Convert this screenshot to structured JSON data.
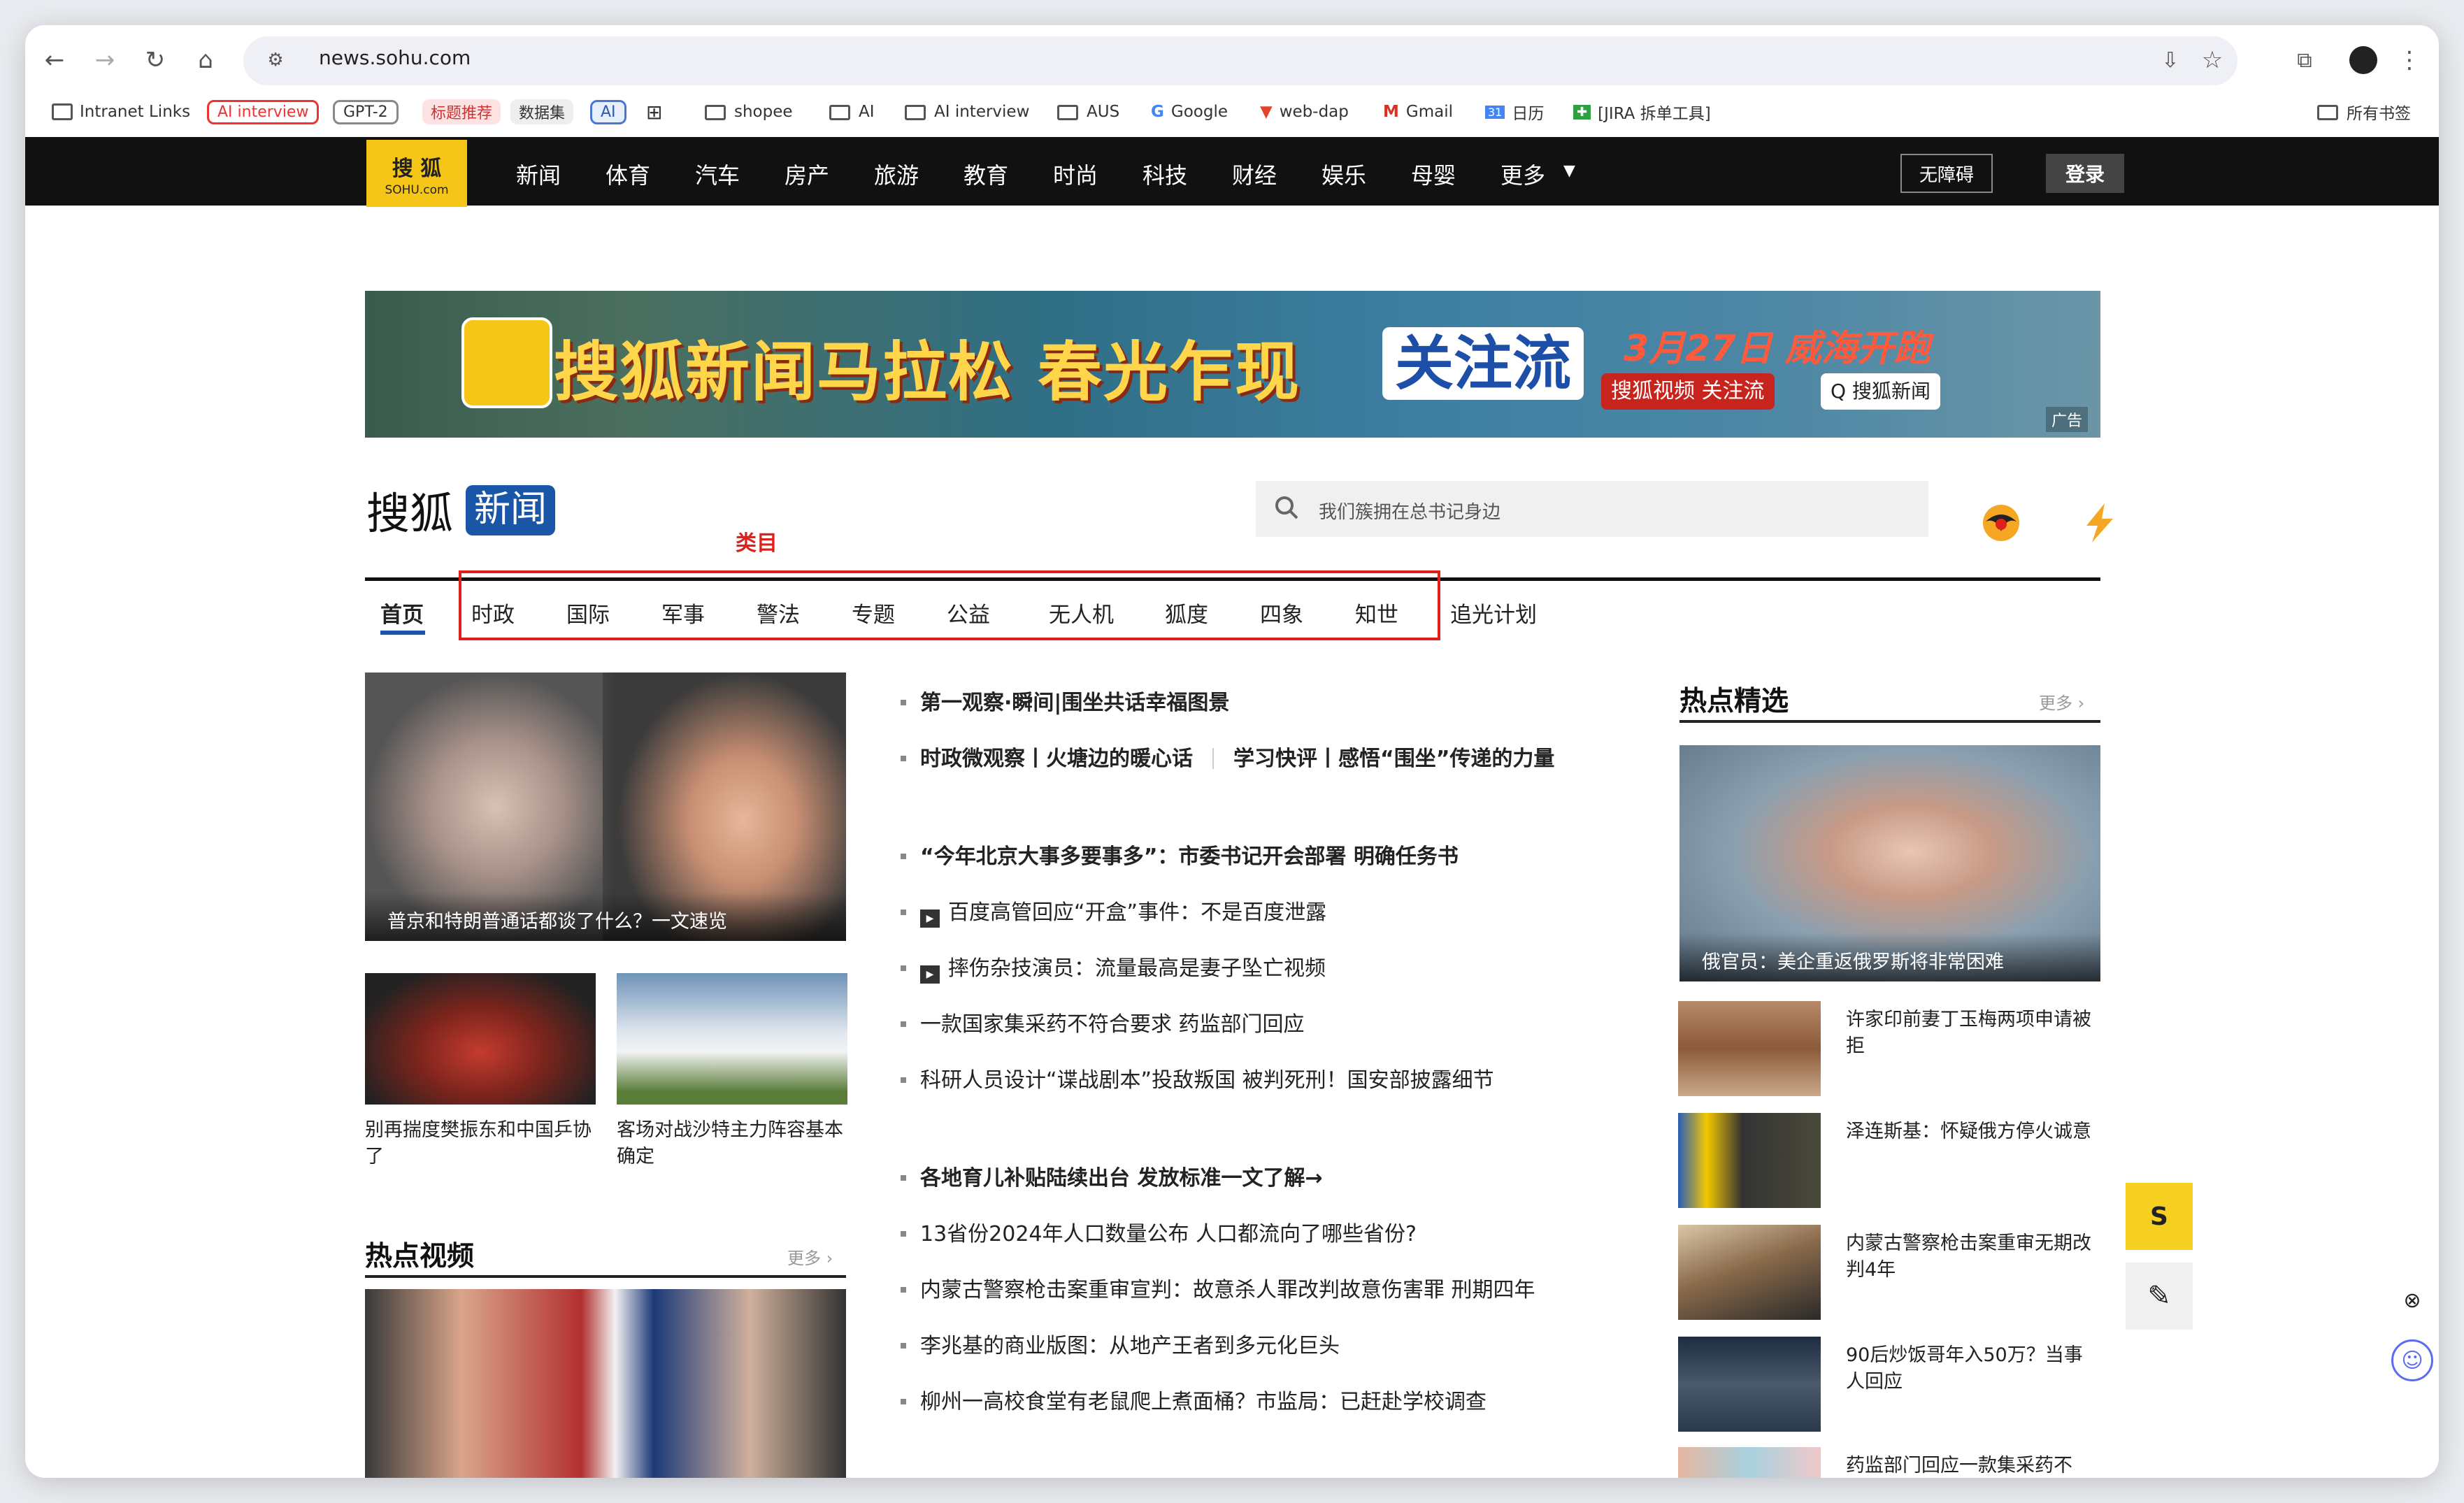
{
  "browser": {
    "url": "news.sohu.com",
    "bookmarks": [
      {
        "label": "Intranet Links",
        "kind": "link"
      },
      {
        "label": "AI interview",
        "kind": "pill-red"
      },
      {
        "label": "GPT-2",
        "kind": "pill"
      },
      {
        "label": "标题推荐",
        "kind": "pill-pink"
      },
      {
        "label": "数据集",
        "kind": "pill-grey"
      },
      {
        "label": "AI",
        "kind": "pill-blue"
      },
      {
        "label": "shopee",
        "kind": "folder"
      },
      {
        "label": "AI",
        "kind": "folder"
      },
      {
        "label": "AI interview",
        "kind": "folder"
      },
      {
        "label": "AUS",
        "kind": "folder"
      },
      {
        "label": "Google",
        "kind": "link"
      },
      {
        "label": "web-dap",
        "kind": "link"
      },
      {
        "label": "Gmail",
        "kind": "link"
      },
      {
        "label": "日历",
        "kind": "link"
      },
      {
        "label": "[JIRA 拆单工具]",
        "kind": "link"
      }
    ],
    "all_bookmarks": "所有书签"
  },
  "site": {
    "logo_line1": "搜 狐",
    "logo_line2": "SOHU.com",
    "nav": [
      "新闻",
      "体育",
      "汽车",
      "房产",
      "旅游",
      "教育",
      "时尚",
      "科技",
      "财经",
      "娱乐",
      "母婴",
      "更多"
    ],
    "accessibility": "无障碍",
    "login": "登录"
  },
  "banner": {
    "main": "搜狐新闻马拉松 春光乍现",
    "follow": "关注流",
    "date": "3月27日 威海开跑",
    "video_tag": "搜狐视频 关注流",
    "search_tag": "Q 搜狐新闻",
    "ad": "广告"
  },
  "header": {
    "brand": "搜狐",
    "brand_box": "新闻",
    "search_placeholder": "我们簇拥在总书记身边",
    "category_annotation": "类目"
  },
  "tabs": [
    "首页",
    "时政",
    "国际",
    "军事",
    "警法",
    "专题",
    "公益",
    "无人机",
    "狐度",
    "四象",
    "知世",
    "追光计划"
  ],
  "left": {
    "main_caption": "普京和特朗普通话都谈了什么？一文速览",
    "small1": "别再揣度樊振东和中国乒协了",
    "small2": "客场对战沙特主力阵容基本确定",
    "hot_video_title": "热点视频",
    "more": "更多 ›"
  },
  "news": [
    {
      "text": "第一观察·瞬间|围坐共话幸福图景",
      "bold": true,
      "video": false
    },
    {
      "text": "时政微观察丨火塘边的暖心话",
      "bold": true,
      "video": false,
      "second": "学习快评丨感悟“围坐”传递的力量"
    },
    {
      "text": "“今年北京大事多要事多”：市委书记开会部署 明确任务书",
      "bold": true,
      "video": false
    },
    {
      "text": "百度高管回应“开盒”事件：不是百度泄露",
      "bold": false,
      "video": true
    },
    {
      "text": "摔伤杂技演员：流量最高是妻子坠亡视频",
      "bold": false,
      "video": true
    },
    {
      "text": "一款国家集采药不符合要求 药监部门回应",
      "bold": false,
      "video": false
    },
    {
      "text": "科研人员设计“谍战剧本”投敌叛国 被判死刑！国安部披露细节",
      "bold": false,
      "video": false
    },
    {
      "text": "各地育儿补贴陆续出台 发放标准一文了解→",
      "bold": true,
      "video": false
    },
    {
      "text": "13省份2024年人口数量公布 人口都流向了哪些省份?",
      "bold": false,
      "video": false
    },
    {
      "text": "内蒙古警察枪击案重审宣判：故意杀人罪改判故意伤害罪 刑期四年",
      "bold": false,
      "video": false
    },
    {
      "text": "李兆基的商业版图：从地产王者到多元化巨头",
      "bold": false,
      "video": false
    },
    {
      "text": "柳州一高校食堂有老鼠爬上煮面桶？市监局：已赶赴学校调查",
      "bold": false,
      "video": false
    }
  ],
  "right": {
    "title": "热点精选",
    "more": "更多 ›",
    "top_caption": "俄官员：美企重返俄罗斯将非常困难",
    "items": [
      "许家印前妻丁玉梅两项申请被拒",
      "泽连斯基：怀疑俄方停火诚意",
      "内蒙古警察枪击案重审无期改判4年",
      "90后炒饭哥年入50万？当事人回应",
      "药监部门回应一款集采药不"
    ]
  }
}
